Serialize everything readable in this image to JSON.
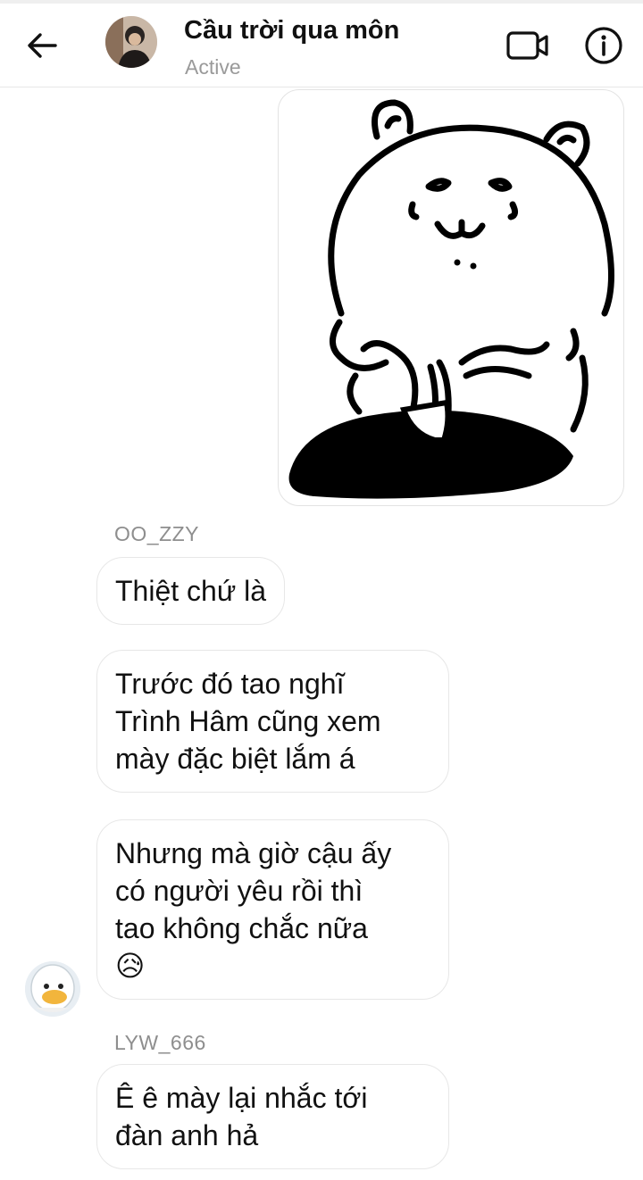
{
  "header": {
    "title": "Cầu trời qua môn",
    "status": "Active",
    "icons": {
      "back": "arrow-left-icon",
      "video": "video-camera-icon",
      "info": "info-icon"
    }
  },
  "messages": [
    {
      "sender": "OO_ZZY"
    },
    {
      "lines": [
        "Thiệt chứ là"
      ]
    },
    {
      "lines": [
        "Trước đó tao nghĩ",
        "Trình Hâm cũng xem",
        "mày đặc biệt lắm á"
      ]
    },
    {
      "lines": [
        "Nhưng mà giờ cậu ấy",
        "có người yêu rồi thì",
        "tao không chắc nữa"
      ],
      "emoji": "😥"
    },
    {
      "sender": "LYW_666"
    },
    {
      "lines": [
        "Ê ê mày lại nhắc tới",
        "đàn anh hả"
      ]
    }
  ],
  "colors": {
    "border": "#e7e7e7",
    "muted": "#8e8e8e",
    "text": "#111111"
  }
}
